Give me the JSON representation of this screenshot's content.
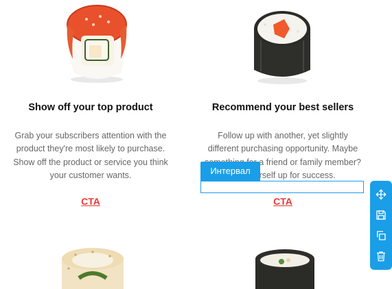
{
  "products": [
    {
      "title": "Show off your top product",
      "body_lines": [
        "Grab your subscribers attention with the",
        "product they're most likely to purchase.",
        "Show off the product or service you think",
        "your customer wants."
      ],
      "cta": "CTA"
    },
    {
      "title": "Recommend your best sellers",
      "body_lines": [
        "Follow up with another, yet slightly",
        "different purchasing opportunity. Maybe",
        "something for a friend or family member?",
        "Set yourself up for success."
      ],
      "cta": "CTA"
    }
  ],
  "editor": {
    "interval_label": "Интервал",
    "accent_color": "#1a9ee8",
    "toolbar_icons": [
      "move-icon",
      "save-icon",
      "copy-icon",
      "trash-icon"
    ]
  },
  "colors": {
    "cta": "#e53935"
  }
}
